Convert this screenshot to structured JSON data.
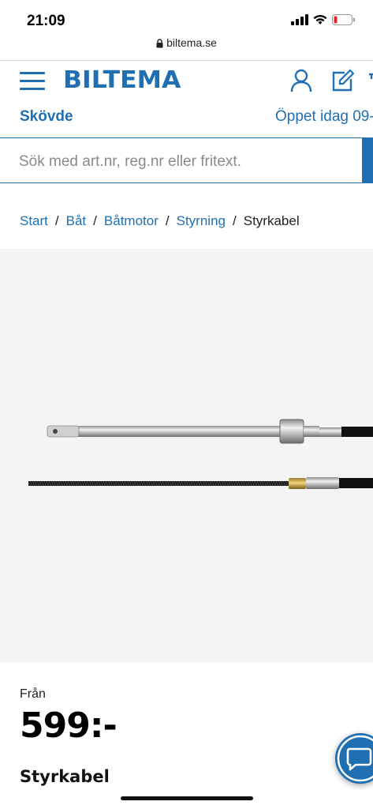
{
  "status_bar": {
    "time": "21:09"
  },
  "browser": {
    "url": "biltema.se"
  },
  "header": {
    "logo": "BILTEMA",
    "icons": [
      "menu-icon",
      "account-icon",
      "edit-icon"
    ]
  },
  "store": {
    "name": "Skövde",
    "hours": "Öppet idag 09-"
  },
  "search": {
    "placeholder": "Sök med art.nr, reg.nr eller fritext."
  },
  "breadcrumb": {
    "items": [
      "Start",
      "Båt",
      "Båtmotor",
      "Styrning"
    ],
    "current": "Styrkabel"
  },
  "product": {
    "price_prefix": "Från",
    "price": "599:-",
    "title": "Styrkabel"
  },
  "colors": {
    "brand": "#1f6fb2",
    "image_bg": "#f4f4f4"
  }
}
